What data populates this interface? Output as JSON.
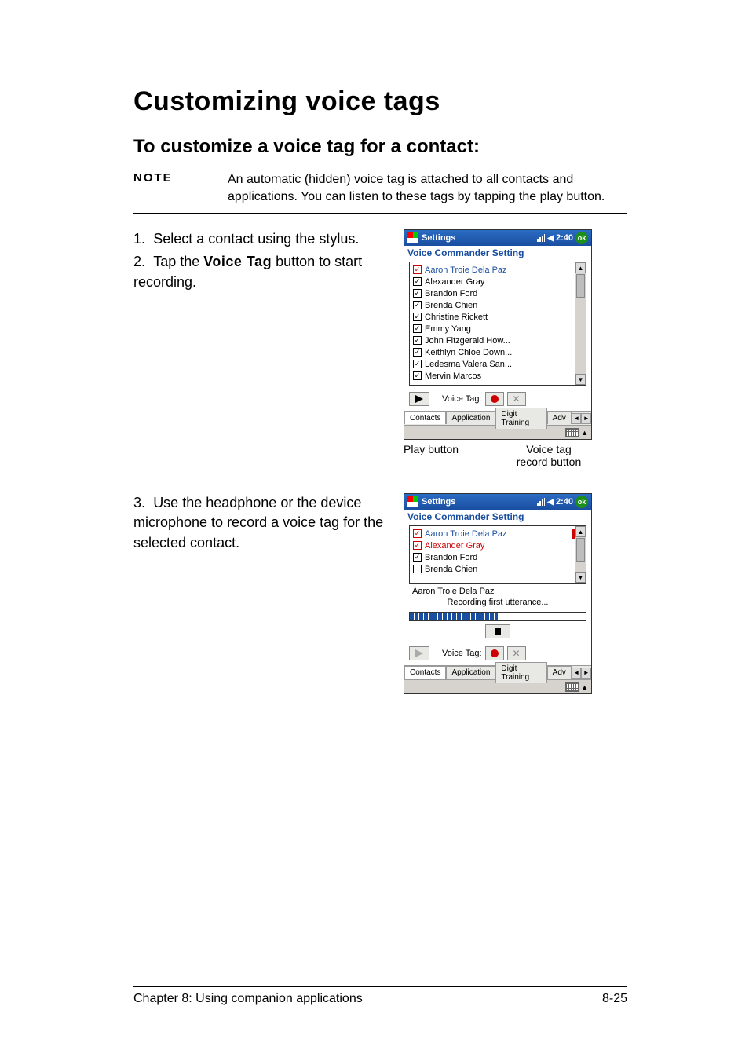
{
  "heading": "Customizing voice tags",
  "subheading": "To customize a voice tag for a contact:",
  "note": {
    "label": "NOTE",
    "text": "An automatic (hidden) voice tag is attached to all contacts and applications. You can listen to these tags by tapping the play button."
  },
  "steps": {
    "s1": "Select a contact using the stylus.",
    "s2a": "Tap the ",
    "s2b": "Voice Tag",
    "s2c": " button to start recording.",
    "s3": "Use the headphone or the device microphone to record a voice tag for the selected contact."
  },
  "ppc": {
    "title": "Settings",
    "time": "2:40",
    "ok": "ok",
    "subtitle": "Voice Commander Setting",
    "contacts": [
      "Aaron Troie Dela Paz",
      "Alexander Gray",
      "Brandon Ford",
      "Brenda Chien",
      "Christine Rickett",
      "Emmy Yang",
      "John Fitzgerald How...",
      "Keithlyn Chloe Down...",
      "Ledesma Valera San...",
      "Mervin Marcos"
    ],
    "voice_tag_label": "Voice Tag:",
    "tabs": [
      "Contacts",
      "Application",
      "Digit Training",
      "Adv"
    ],
    "recording": {
      "name": "Aaron Troie Dela Paz",
      "msg": "Recording first utterance..."
    }
  },
  "captions": {
    "play": "Play button",
    "record_l1": "Voice tag",
    "record_l2": "record button"
  },
  "footer": {
    "left": "Chapter 8: Using companion applications",
    "right": "8-25"
  }
}
